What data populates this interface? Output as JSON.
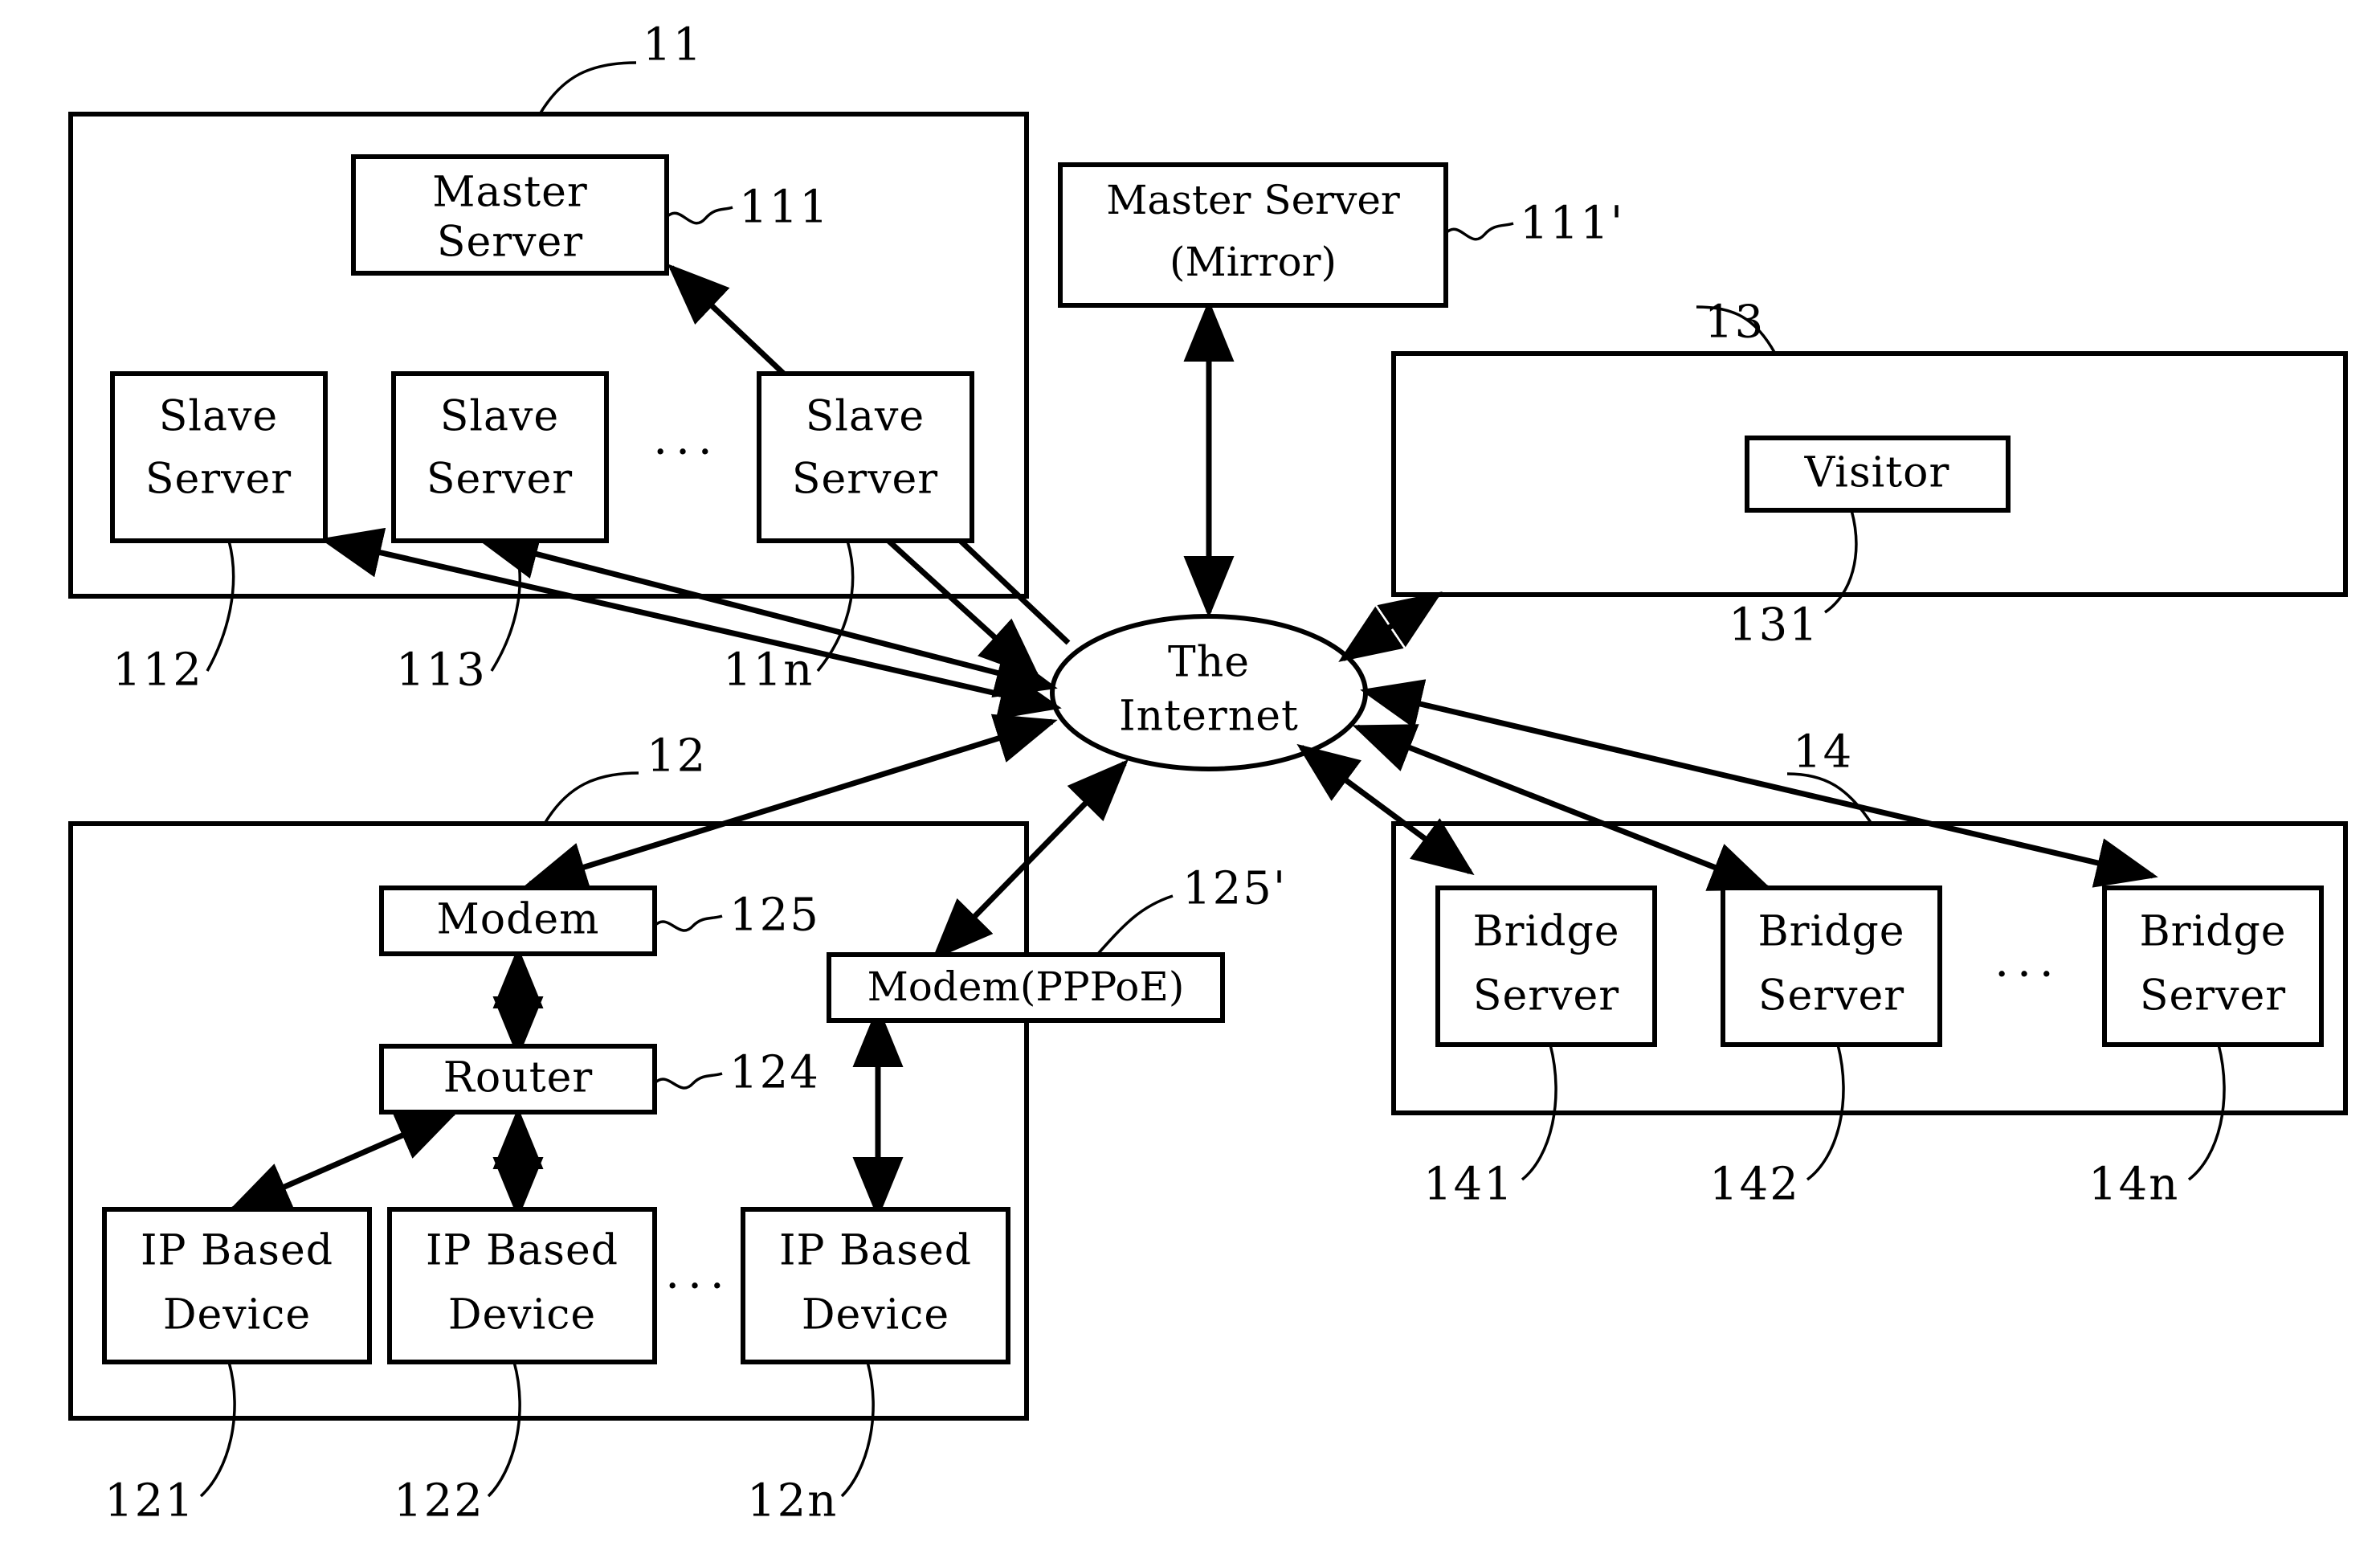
{
  "figure": {
    "title": "Network system architecture diagram",
    "type": "patent-block-diagram",
    "background_color": "#ffffff",
    "line_color": "#000000"
  },
  "hub": {
    "label_line1": "The",
    "label_line2": "Internet",
    "ref": ""
  },
  "groups": [
    {
      "id": "g11",
      "ref": "11",
      "name": "server-farm-group"
    },
    {
      "id": "g13",
      "ref": "13",
      "name": "visitor-group"
    },
    {
      "id": "g12",
      "ref": "12",
      "name": "premises-group"
    },
    {
      "id": "g14",
      "ref": "14",
      "name": "bridge-server-group"
    }
  ],
  "nodes": {
    "master_server": {
      "line1": "Master",
      "line2": "Server",
      "ref": "111"
    },
    "master_server_mirror": {
      "line1": "Master Server",
      "line2": "(Mirror)",
      "ref": "111'"
    },
    "slave_server_1": {
      "line1": "Slave",
      "line2": "Server",
      "ref": "112"
    },
    "slave_server_2": {
      "line1": "Slave",
      "line2": "Server",
      "ref": "113"
    },
    "slave_server_n": {
      "line1": "Slave",
      "line2": "Server",
      "ref": "11n"
    },
    "visitor": {
      "line1": "Visitor",
      "line2": "",
      "ref": "131"
    },
    "modem": {
      "line1": "Modem",
      "line2": "",
      "ref": "125"
    },
    "modem_pppoe": {
      "line1": "Modem(PPPoE)",
      "line2": "",
      "ref": "125'"
    },
    "router": {
      "line1": "Router",
      "line2": "",
      "ref": "124"
    },
    "ip_device_1": {
      "line1": "IP Based",
      "line2": "Device",
      "ref": "121"
    },
    "ip_device_2": {
      "line1": "IP Based",
      "line2": "Device",
      "ref": "122"
    },
    "ip_device_n": {
      "line1": "IP Based",
      "line2": "Device",
      "ref": "12n"
    },
    "bridge_server_1": {
      "line1": "Bridge",
      "line2": "Server",
      "ref": "141"
    },
    "bridge_server_2": {
      "line1": "Bridge",
      "line2": "Server",
      "ref": "142"
    },
    "bridge_server_n": {
      "line1": "Bridge",
      "line2": "Server",
      "ref": "14n"
    }
  },
  "ellipses_marks": {
    "slave_row": "...",
    "ip_device_row": "...",
    "bridge_row": "..."
  }
}
